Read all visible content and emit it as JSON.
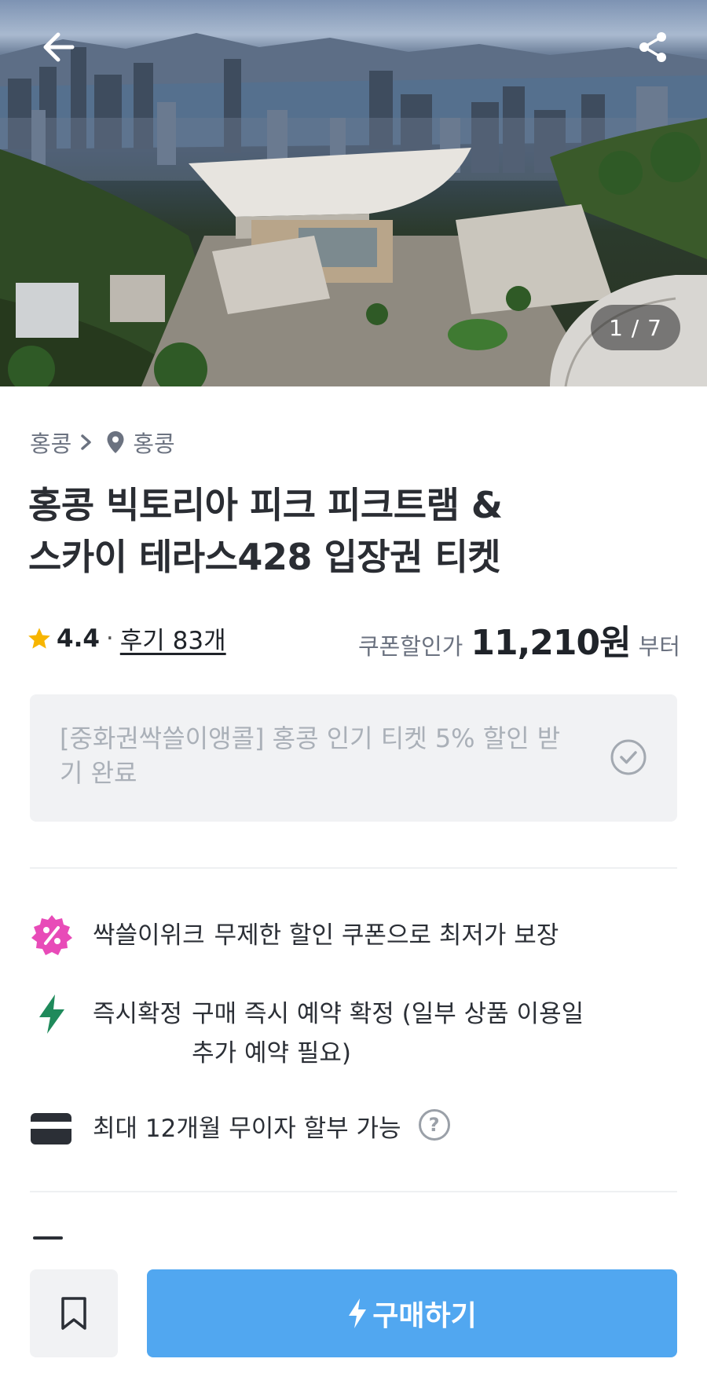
{
  "hero": {
    "image_counter": "1 / 7",
    "back_icon": "arrow-left-icon",
    "share_icon": "share-icon"
  },
  "breadcrumb": {
    "region": "홍콩",
    "separator_icon": "chevron-right-icon",
    "location_icon": "location-pin-icon",
    "city": "홍콩"
  },
  "product": {
    "title_line1": "홍콩 빅토리아 피크 피크트램 &",
    "title_line2": "스카이 테라스428 입장권 티켓"
  },
  "rating": {
    "star_icon": "star-icon",
    "score": "4.4",
    "separator": "·",
    "reviews_label": "후기 83개"
  },
  "price": {
    "label": "쿠폰할인가",
    "amount": "11,210원",
    "suffix": "부터"
  },
  "coupon": {
    "text": "[중화권싹쓸이앵콜] 홍콩 인기 티켓 5% 할인 받기 완료",
    "status_icon": "check-circle-icon"
  },
  "features": [
    {
      "icon": "discount-badge-icon",
      "title": "싹쓸이위크",
      "text": "무제한 할인 쿠폰으로 최저가 보장"
    },
    {
      "icon": "lightning-icon",
      "title": "즉시확정",
      "text": "구매 즉시 예약 확정 (일부 상품 이용일 추가 예약 필요)"
    },
    {
      "icon": "card-icon",
      "title": "",
      "text": "최대 12개월 무이자 할부 가능",
      "help_label": "?"
    }
  ],
  "bottom": {
    "bookmark_icon": "bookmark-icon",
    "buy_label": "구매하기",
    "buy_icon": "lightning-icon"
  },
  "colors": {
    "primary": "#51a7f0",
    "discount_badge": "#e84bb8",
    "lightning": "#1f8a5b",
    "star": "#f7b500"
  }
}
